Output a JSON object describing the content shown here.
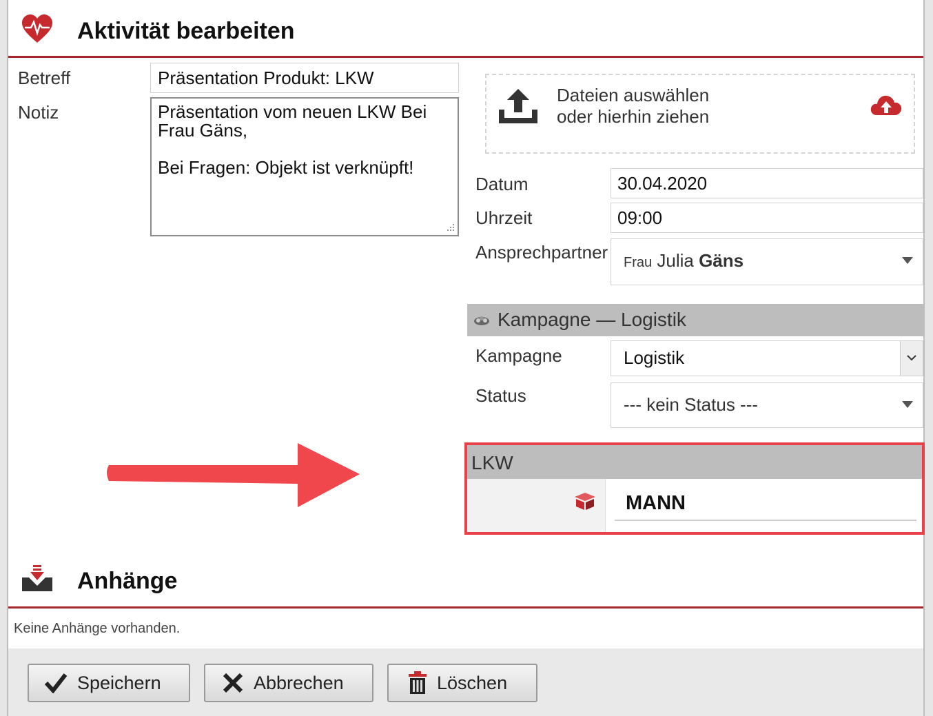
{
  "header": {
    "title": "Aktivität bearbeiten",
    "icon": "heart-pulse-icon"
  },
  "form": {
    "subject_label": "Betreff",
    "subject_value": "Präsentation Produkt: LKW",
    "note_label": "Notiz",
    "note_line1": "Präsentation vom neuen LKW Bei",
    "note_line2": "Frau Gäns,",
    "note_line3": "Bei Fragen: Objekt ist verknüpft!"
  },
  "upload": {
    "line1": "Dateien auswählen",
    "line2": "oder hierhin ziehen"
  },
  "details": {
    "date_label": "Datum",
    "date_value": "30.04.2020",
    "time_label": "Uhrzeit",
    "time_value": "09:00",
    "contact_label": "Ansprechpartner",
    "contact_salutation": "Frau",
    "contact_first": "Julia",
    "contact_last": "Gäns"
  },
  "campaign": {
    "section_title": "Kampagne — Logistik",
    "campaign_label": "Kampagne",
    "campaign_value": "Logistik",
    "status_label": "Status",
    "status_value": "--- kein Status ---"
  },
  "linked_object": {
    "section_title": "LKW",
    "value": "MANN"
  },
  "attachments": {
    "title": "Anhänge",
    "empty_text": "Keine Anhänge vorhanden."
  },
  "buttons": {
    "save": "Speichern",
    "cancel": "Abbrechen",
    "delete": "Löschen"
  },
  "colors": {
    "accent_red": "#a8262b",
    "highlight_red": "#e8414a",
    "arrow_red": "#f0474c",
    "section_gray": "#bdbdbd"
  }
}
